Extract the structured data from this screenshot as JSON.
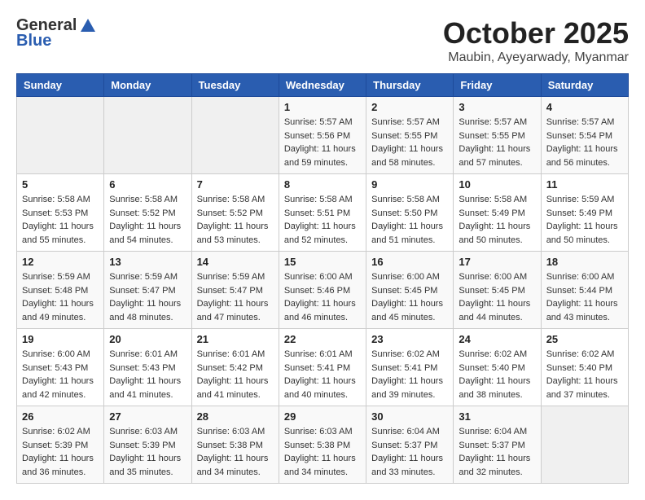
{
  "header": {
    "logo_line1": "General",
    "logo_line2": "Blue",
    "month": "October 2025",
    "location": "Maubin, Ayeyarwady, Myanmar"
  },
  "days_of_week": [
    "Sunday",
    "Monday",
    "Tuesday",
    "Wednesday",
    "Thursday",
    "Friday",
    "Saturday"
  ],
  "weeks": [
    [
      {
        "day": "",
        "info": ""
      },
      {
        "day": "",
        "info": ""
      },
      {
        "day": "",
        "info": ""
      },
      {
        "day": "1",
        "info": "Sunrise: 5:57 AM\nSunset: 5:56 PM\nDaylight: 11 hours\nand 59 minutes."
      },
      {
        "day": "2",
        "info": "Sunrise: 5:57 AM\nSunset: 5:55 PM\nDaylight: 11 hours\nand 58 minutes."
      },
      {
        "day": "3",
        "info": "Sunrise: 5:57 AM\nSunset: 5:55 PM\nDaylight: 11 hours\nand 57 minutes."
      },
      {
        "day": "4",
        "info": "Sunrise: 5:57 AM\nSunset: 5:54 PM\nDaylight: 11 hours\nand 56 minutes."
      }
    ],
    [
      {
        "day": "5",
        "info": "Sunrise: 5:58 AM\nSunset: 5:53 PM\nDaylight: 11 hours\nand 55 minutes."
      },
      {
        "day": "6",
        "info": "Sunrise: 5:58 AM\nSunset: 5:52 PM\nDaylight: 11 hours\nand 54 minutes."
      },
      {
        "day": "7",
        "info": "Sunrise: 5:58 AM\nSunset: 5:52 PM\nDaylight: 11 hours\nand 53 minutes."
      },
      {
        "day": "8",
        "info": "Sunrise: 5:58 AM\nSunset: 5:51 PM\nDaylight: 11 hours\nand 52 minutes."
      },
      {
        "day": "9",
        "info": "Sunrise: 5:58 AM\nSunset: 5:50 PM\nDaylight: 11 hours\nand 51 minutes."
      },
      {
        "day": "10",
        "info": "Sunrise: 5:58 AM\nSunset: 5:49 PM\nDaylight: 11 hours\nand 50 minutes."
      },
      {
        "day": "11",
        "info": "Sunrise: 5:59 AM\nSunset: 5:49 PM\nDaylight: 11 hours\nand 50 minutes."
      }
    ],
    [
      {
        "day": "12",
        "info": "Sunrise: 5:59 AM\nSunset: 5:48 PM\nDaylight: 11 hours\nand 49 minutes."
      },
      {
        "day": "13",
        "info": "Sunrise: 5:59 AM\nSunset: 5:47 PM\nDaylight: 11 hours\nand 48 minutes."
      },
      {
        "day": "14",
        "info": "Sunrise: 5:59 AM\nSunset: 5:47 PM\nDaylight: 11 hours\nand 47 minutes."
      },
      {
        "day": "15",
        "info": "Sunrise: 6:00 AM\nSunset: 5:46 PM\nDaylight: 11 hours\nand 46 minutes."
      },
      {
        "day": "16",
        "info": "Sunrise: 6:00 AM\nSunset: 5:45 PM\nDaylight: 11 hours\nand 45 minutes."
      },
      {
        "day": "17",
        "info": "Sunrise: 6:00 AM\nSunset: 5:45 PM\nDaylight: 11 hours\nand 44 minutes."
      },
      {
        "day": "18",
        "info": "Sunrise: 6:00 AM\nSunset: 5:44 PM\nDaylight: 11 hours\nand 43 minutes."
      }
    ],
    [
      {
        "day": "19",
        "info": "Sunrise: 6:00 AM\nSunset: 5:43 PM\nDaylight: 11 hours\nand 42 minutes."
      },
      {
        "day": "20",
        "info": "Sunrise: 6:01 AM\nSunset: 5:43 PM\nDaylight: 11 hours\nand 41 minutes."
      },
      {
        "day": "21",
        "info": "Sunrise: 6:01 AM\nSunset: 5:42 PM\nDaylight: 11 hours\nand 41 minutes."
      },
      {
        "day": "22",
        "info": "Sunrise: 6:01 AM\nSunset: 5:41 PM\nDaylight: 11 hours\nand 40 minutes."
      },
      {
        "day": "23",
        "info": "Sunrise: 6:02 AM\nSunset: 5:41 PM\nDaylight: 11 hours\nand 39 minutes."
      },
      {
        "day": "24",
        "info": "Sunrise: 6:02 AM\nSunset: 5:40 PM\nDaylight: 11 hours\nand 38 minutes."
      },
      {
        "day": "25",
        "info": "Sunrise: 6:02 AM\nSunset: 5:40 PM\nDaylight: 11 hours\nand 37 minutes."
      }
    ],
    [
      {
        "day": "26",
        "info": "Sunrise: 6:02 AM\nSunset: 5:39 PM\nDaylight: 11 hours\nand 36 minutes."
      },
      {
        "day": "27",
        "info": "Sunrise: 6:03 AM\nSunset: 5:39 PM\nDaylight: 11 hours\nand 35 minutes."
      },
      {
        "day": "28",
        "info": "Sunrise: 6:03 AM\nSunset: 5:38 PM\nDaylight: 11 hours\nand 34 minutes."
      },
      {
        "day": "29",
        "info": "Sunrise: 6:03 AM\nSunset: 5:38 PM\nDaylight: 11 hours\nand 34 minutes."
      },
      {
        "day": "30",
        "info": "Sunrise: 6:04 AM\nSunset: 5:37 PM\nDaylight: 11 hours\nand 33 minutes."
      },
      {
        "day": "31",
        "info": "Sunrise: 6:04 AM\nSunset: 5:37 PM\nDaylight: 11 hours\nand 32 minutes."
      },
      {
        "day": "",
        "info": ""
      }
    ]
  ]
}
